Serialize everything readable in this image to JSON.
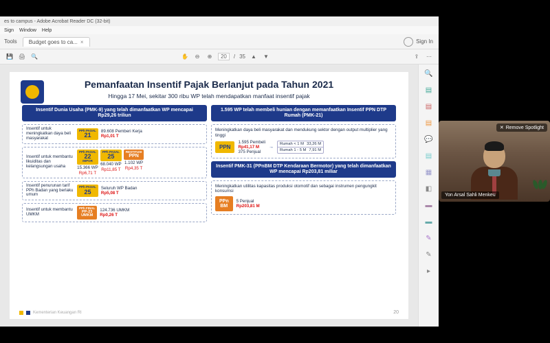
{
  "window": {
    "title": "es to campus - Adobe Acrobat Reader DC (32-bit)",
    "menu": [
      "Sign",
      "Window",
      "Help"
    ],
    "tools_label": "Tools",
    "tab_name": "Budget goes to ca...",
    "signin": "Sign In",
    "page_current": "20",
    "page_total": "35"
  },
  "slide": {
    "title": "Pemanfaatan Insentif Pajak Berlanjut pada Tahun 2021",
    "subtitle": "Hingga 17 Mei, sekitar 300 ribu WP telah mendapatkan manfaat insentif pajak",
    "pagenum": "20",
    "footer": "Kementerian Keuangan RI",
    "left": {
      "banner": "Insentif Dunia Usaha (PMK-9) yang telah dimanfaatkan WP mencapai Rp29,26 triliun",
      "r1_label": "Insentif untuk meningkatkan daya beli masyarakat",
      "r1_badge_top": "PPh PASAL",
      "r1_badge_num": "21",
      "r1_stat1": "89.608 Pemberi Kerja",
      "r1_stat2": "Rp1,01 T",
      "r2_label": "Insentif untuk membantu likuiditas dan kelangsungan usaha",
      "r2_b1_top": "PPh PASAL",
      "r2_b1_num": "22",
      "r2_b1_sub": "IMPOR",
      "r2_b2_top": "PPh PASAL",
      "r2_b2_num": "25",
      "r2_b3_top": "RESTITUSI",
      "r2_b3_txt": "PPN",
      "r2_s1a": "15.366 WP",
      "r2_s1b": "Rp6,71 T",
      "r2_s2a": "68.040 WP",
      "r2_s2b": "Rp11,85 T",
      "r2_s3a": "1.102 WP",
      "r2_s3b": "Rp4,35 T",
      "r3_label": "Insentif penurunan tarif PPh Badan yang berlaku umum",
      "r3_badge_top": "PPh PASAL",
      "r3_badge_num": "25",
      "r3_stat1": "Seluruh WP Badan",
      "r3_stat2": "Rp5,08 T",
      "r4_label": "Insentif untuk membantu UMKM",
      "r4_badge_top": "PPh FINAL",
      "r4_badge_txt1": "PP-23",
      "r4_badge_txt2": "UMKM",
      "r4_stat1": "124.736 UMKM",
      "r4_stat2": "Rp0,26 T"
    },
    "right": {
      "banner1": "1.595 WP telah membeli hunian dengan memanfaatkan Insentif PPN DTP Rumah (PMK-21)",
      "desc1": "Meningkatkan daya beli masyarakat dan mendukung sektor dengan output multiplier yang tinggi",
      "ppn_label": "PPN",
      "ppn_buyers": "1.595 Pembeli",
      "ppn_amount": "Rp41,17 M",
      "ppn_sellers": "375 Penjual",
      "table_r1a": "Rumah < 1 M",
      "table_r1b": "33,26 M",
      "table_r2a": "Rumah 1 - 5 M",
      "table_r2b": "7,91 M",
      "banner2": "Insentif PMK-31 (PPnBM DTP Kendaraan Bermotor) yang telah dimanfaatkan WP mencapai Rp203,81 miliar",
      "desc2": "Meningkatkan utilitas kapasitas produksi otomotif dan sebagai instrumen pengungkit konsumsi",
      "ppnbm_label1": "PPn",
      "ppnbm_label2": "BM",
      "ppnbm_sellers": "5 Penjual",
      "ppnbm_amount": "Rp203,81 M"
    }
  },
  "video": {
    "spotlight": "Remove Spotlight",
    "name": "Yon Arsal Sahli Menkeu"
  }
}
